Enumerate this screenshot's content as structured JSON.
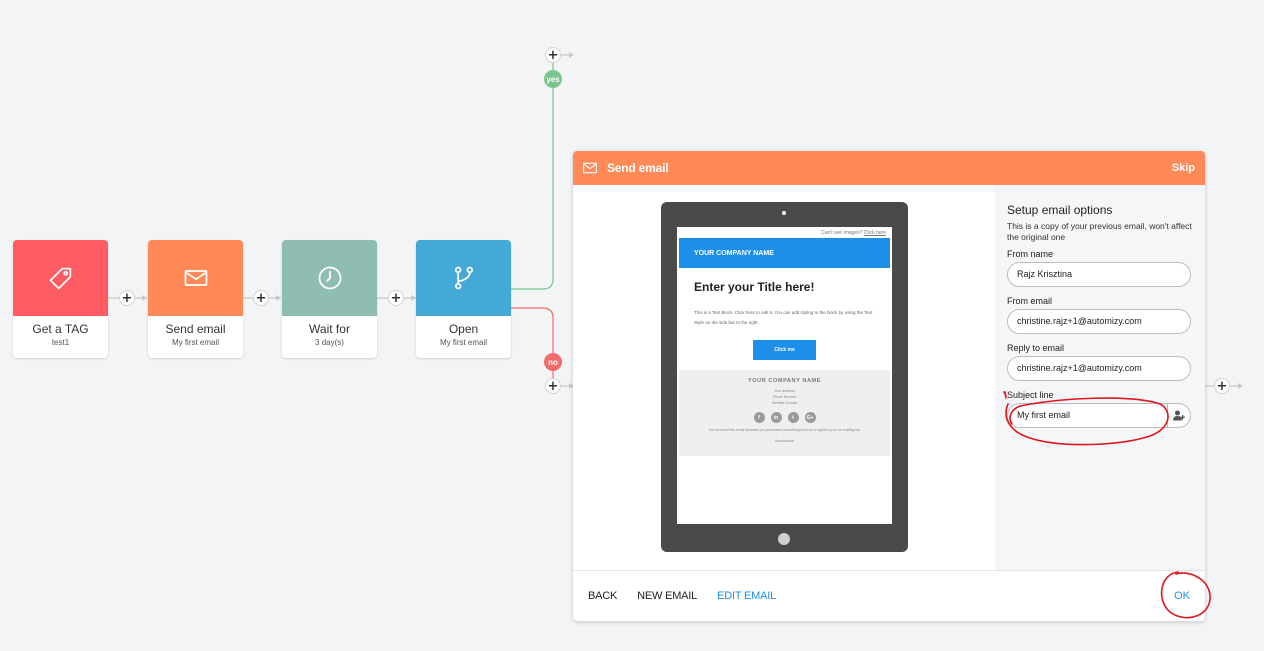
{
  "flow": {
    "nodes": [
      {
        "title": "Get a TAG",
        "subtitle": "test1",
        "color": "#ff5b63",
        "icon": "tag-icon"
      },
      {
        "title": "Send email",
        "subtitle": "My first email",
        "color": "#ff8a57",
        "icon": "envelope-icon"
      },
      {
        "title": "Wait for",
        "subtitle": "3 day(s)",
        "color": "#8fbdb1",
        "icon": "clock-icon"
      },
      {
        "title": "Open",
        "subtitle": "My first email",
        "color": "#44a9d6",
        "icon": "branch-icon"
      }
    ],
    "branch_yes": "yes",
    "branch_no": "no",
    "yes_color": "#7dc58e",
    "no_color": "#f46b6b",
    "plus_symbol": "+"
  },
  "modal": {
    "title": "Send email",
    "skip_label": "Skip",
    "header_color": "#ff8a57",
    "preview": {
      "top_line": "Can't see images?",
      "top_link": "Click here",
      "company_name": "YOUR COMPANY NAME",
      "title": "Enter your Title here!",
      "body_text": "This is a Text Block. Click here to edit it. You can add styling to the block by using the Text Style on the side bar to the right.",
      "button_label": "Click me",
      "footer_company": "YOUR COMPANY NAME",
      "footer_address": "Your address",
      "footer_phone": "Phone Number",
      "footer_website": "Website Domain",
      "footer_social": [
        "f",
        "in",
        "t",
        "G+"
      ],
      "footer_statement": "You received this email because you purchased something from us or signed up to our mailing list.",
      "footer_unsubscribe": "Unsubscribe"
    },
    "options": {
      "heading": "Setup email options",
      "note": "This is a copy of your previous email, won't affect the original one",
      "from_name_label": "From name",
      "from_name_value": "Rajz Krisztina",
      "from_email_label": "From email",
      "from_email_value": "christine.rajz+1@automizy.com",
      "reply_to_label": "Reply to email",
      "reply_to_value": "christine.rajz+1@automizy.com",
      "subject_label": "Subject line",
      "subject_value": "My first email",
      "subject_icon": "add-person-icon"
    },
    "footer": {
      "back": "BACK",
      "new_email": "NEW EMAIL",
      "edit_email": "EDIT EMAIL",
      "ok": "OK"
    }
  }
}
